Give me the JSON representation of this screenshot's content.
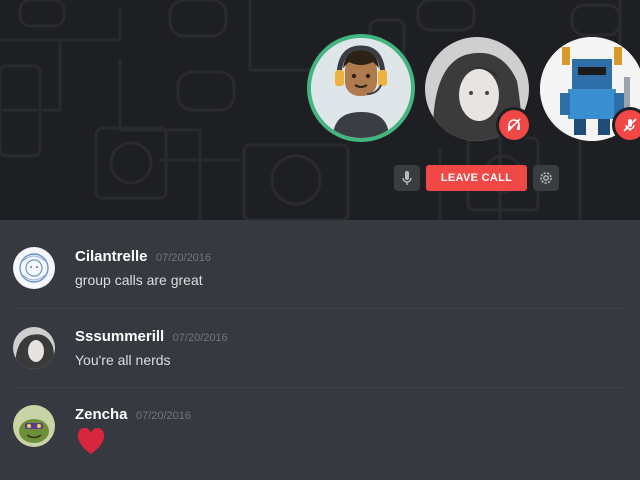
{
  "call": {
    "participants": [
      {
        "name": "Cilantrelle",
        "speaking": true
      },
      {
        "name": "Sssummerill",
        "status_icon": "headphones-muted-icon"
      },
      {
        "name": "Zencha",
        "status_icon": "mic-muted-icon"
      }
    ],
    "controls": {
      "mic_icon": "microphone-icon",
      "leave_label": "LEAVE CALL",
      "settings_icon": "gear-icon"
    }
  },
  "messages": [
    {
      "username": "Cilantrelle",
      "timestamp": "07/20/2016",
      "text": "group calls are great"
    },
    {
      "username": "Sssummerill",
      "timestamp": "07/20/2016",
      "text": "You're all nerds"
    },
    {
      "username": "Zencha",
      "timestamp": "07/20/2016",
      "emoji": "heart-emoji"
    }
  ],
  "colors": {
    "call_bg": "#1e1f22",
    "chat_bg": "#36393f",
    "leave_button": "#f04747",
    "speaking_ring": "#43b581",
    "muted_badge": "#f04747"
  }
}
